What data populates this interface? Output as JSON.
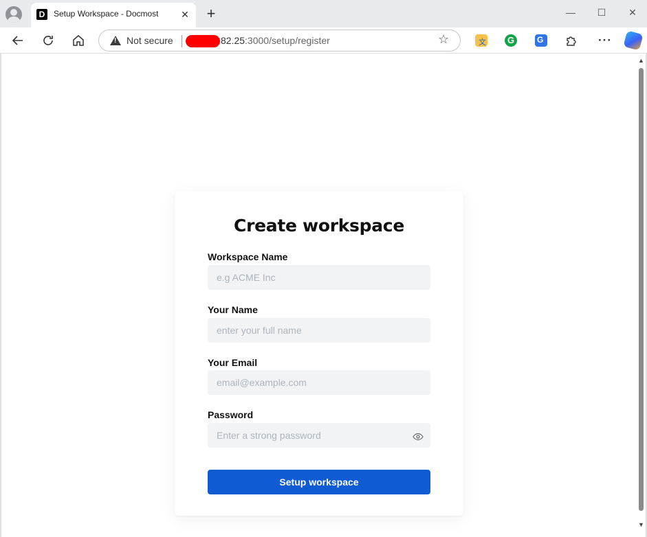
{
  "browser": {
    "tab_title": "Setup Workspace - Docmost",
    "favicon_letter": "D",
    "security_label": "Not secure",
    "url_host_visible": "82.25",
    "url_rest": ":3000/setup/register"
  },
  "form": {
    "title": "Create workspace",
    "fields": [
      {
        "label": "Workspace Name",
        "placeholder": "e.g ACME Inc"
      },
      {
        "label": "Your Name",
        "placeholder": "enter your full name"
      },
      {
        "label": "Your Email",
        "placeholder": "email@example.com"
      },
      {
        "label": "Password",
        "placeholder": "Enter a strong password"
      }
    ],
    "submit_label": "Setup workspace"
  },
  "colors": {
    "primary": "#0f5bd4",
    "input_bg": "#f1f3f5"
  },
  "icons": [
    "profile-icon",
    "close-icon",
    "plus-icon",
    "minimize-icon",
    "maximize-icon",
    "window-close-icon",
    "back-icon",
    "reload-icon",
    "home-icon",
    "warning-icon",
    "star-icon",
    "translate-extension-icon",
    "grammarly-icon",
    "google-translate-icon",
    "extensions-icon",
    "more-icon",
    "copilot-icon",
    "eye-icon"
  ]
}
